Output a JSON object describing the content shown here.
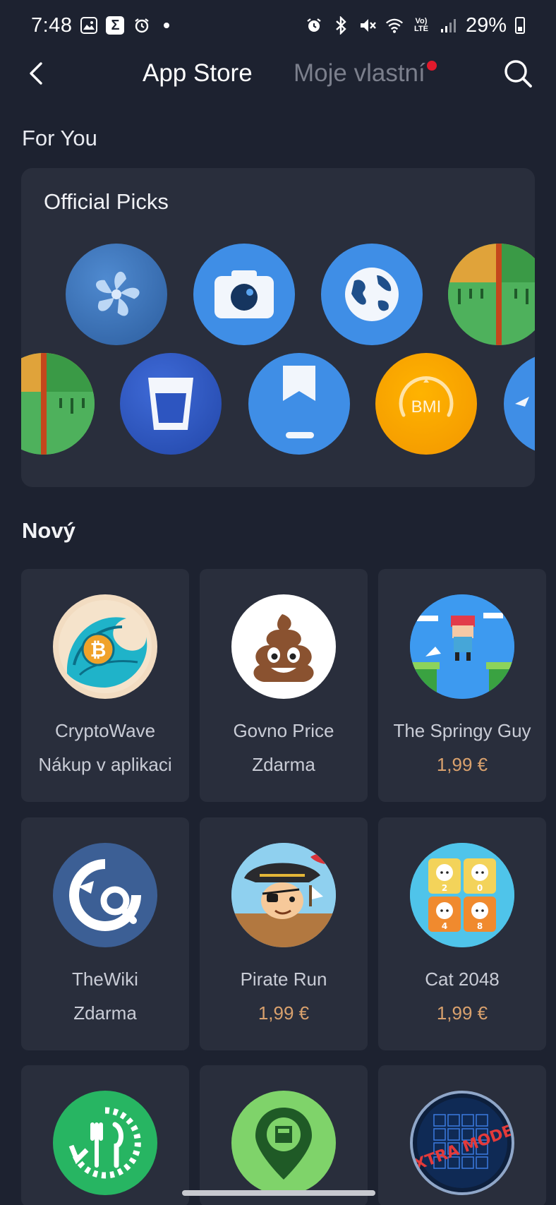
{
  "status_bar": {
    "time": "7:48",
    "battery": "29%",
    "lte": "Vo)\nLTE"
  },
  "header": {
    "tab_store": "App Store",
    "tab_own": "Moje vlastní",
    "has_notification_dot": true
  },
  "for_you": {
    "title": "For You",
    "card_title": "Official Picks",
    "row1_icons": [
      "pinwheel-icon",
      "camera-icon",
      "globe-icon",
      "ruler-icon"
    ],
    "row2_icons": [
      "ruler-icon",
      "water-glass-icon",
      "bookmark-icon",
      "bmi-icon",
      "navigation-icon"
    ],
    "bmi_label": "BMI"
  },
  "new_section": {
    "title": "Nový",
    "apps": [
      {
        "name": "CryptoWave",
        "price": "Nákup v aplikaci",
        "paid": false,
        "icon": "bitcoin-wave-icon"
      },
      {
        "name": "Govno Price",
        "price": "Zdarma",
        "paid": false,
        "icon": "poop-emoji-icon"
      },
      {
        "name": "The Springy Guy",
        "price": "1,99 €",
        "paid": true,
        "icon": "pixel-jumper-icon"
      },
      {
        "name": "TheWiki",
        "price": "Zdarma",
        "paid": false,
        "icon": "wiki-search-icon"
      },
      {
        "name": "Pirate Run",
        "price": "1,99 €",
        "paid": true,
        "icon": "pirate-icon"
      },
      {
        "name": "Cat 2048",
        "price": "1,99 €",
        "paid": true,
        "icon": "cat-tiles-icon"
      },
      {
        "name": "",
        "price": "",
        "paid": false,
        "icon": "meal-timer-icon"
      },
      {
        "name": "",
        "price": "",
        "paid": false,
        "icon": "map-pin-icon"
      },
      {
        "name": "",
        "price": "",
        "paid": false,
        "icon": "extra-modes-icon"
      }
    ],
    "cat_tiles": [
      "2",
      "0",
      "4",
      "8"
    ],
    "extra_modes_text": "EXTRA MODES"
  },
  "colors": {
    "background": "#1d2230",
    "card": "#292e3c",
    "price_accent": "#d9a16d",
    "notification_dot": "#e11a2c"
  }
}
